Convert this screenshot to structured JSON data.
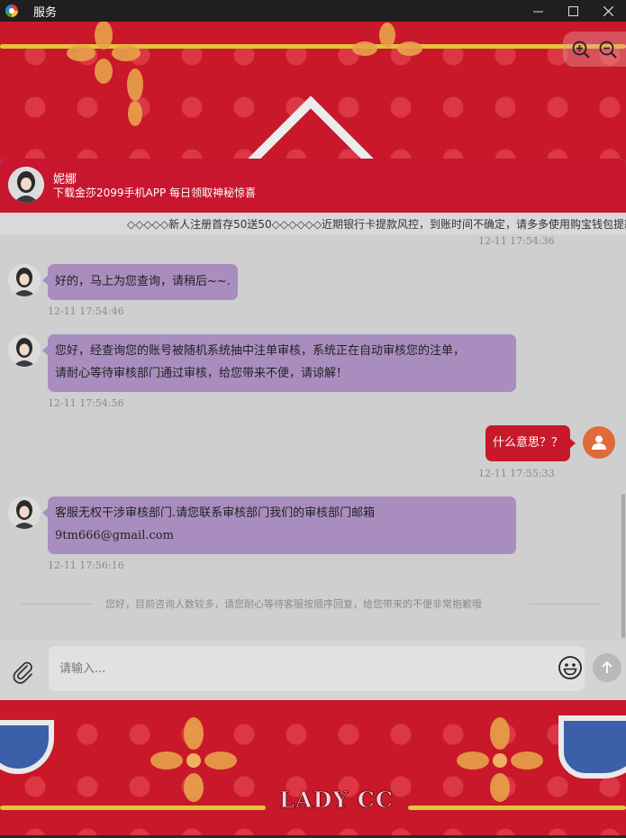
{
  "window": {
    "title": "服务",
    "app_icon": "colorful-app-icon"
  },
  "zoom": {
    "zoom_in_icon": "zoom-in-icon",
    "zoom_out_icon": "zoom-out-icon"
  },
  "header": {
    "agent_name": "妮娜",
    "subtitle": "下载金莎2099手机APP 每日领取神秘惊喜"
  },
  "marquee": {
    "text": "◇◇◇◇◇新人注册首存50送50◇◇◇◇◇◇近期银行卡提款风控，到账时间不确定，请多多使用购宝钱包提款"
  },
  "messages": [
    {
      "type": "timestamp",
      "time": "12-11 17:54:36"
    },
    {
      "type": "incoming",
      "lines": [
        "好的，马上为您查询，请稍后~~."
      ],
      "time": "12-11 17:54:46"
    },
    {
      "type": "incoming",
      "lines": [
        "您好，经查询您的账号被随机系统抽中注单审核，系统正在自动审核您的注单，",
        "请耐心等待审核部门通过审核，给您带来不便，请谅解！"
      ],
      "time": "12-11 17:54:56"
    },
    {
      "type": "outgoing",
      "lines": [
        "什么意思？？"
      ],
      "time": "12-11 17:55:33"
    },
    {
      "type": "incoming",
      "lines": [
        "客服无权干涉审核部门.请您联系审核部门我们的审核部门邮箱",
        "9tm666@gmail.com"
      ],
      "time": "12-11 17:56:16"
    }
  ],
  "system_notice": "您好，目前咨询人数较多，请您耐心等待客服按顺序回复，给您带来的不便非常抱歉哦",
  "composer": {
    "placeholder": "请输入...",
    "attach_icon": "paperclip-icon",
    "emoji_icon": "smiley-icon",
    "send_icon": "arrow-up-icon"
  },
  "background": {
    "brand": "LADY CC"
  },
  "colors": {
    "header_red": "#c8162e",
    "incoming_bubble": "#a98dbf",
    "outgoing_bubble": "#c8192b",
    "user_avatar": "#e06a3a",
    "chat_bg": "#cfcfcf"
  }
}
